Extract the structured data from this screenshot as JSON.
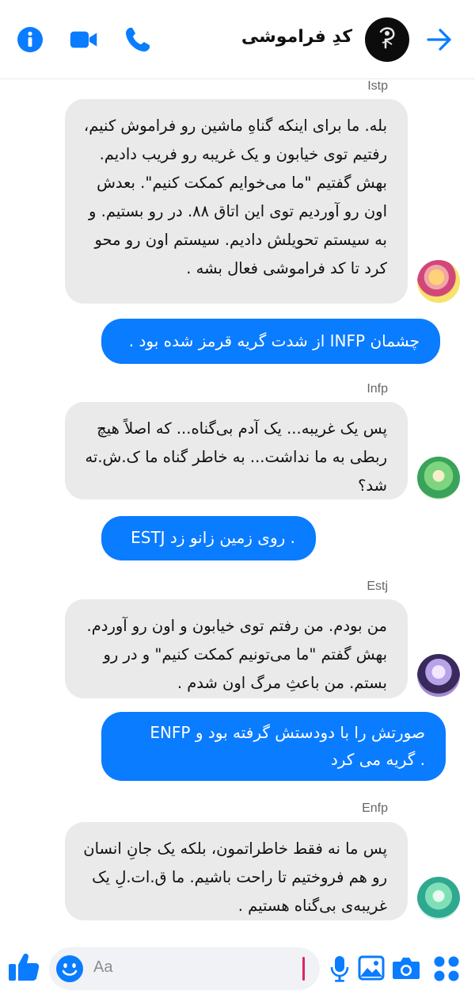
{
  "header": {
    "title": "کدِ فراموشی",
    "icons": [
      "info-icon",
      "video-call-icon",
      "phone-icon",
      "back-arrow-icon"
    ],
    "accent": "#0a7cff"
  },
  "messages": [
    {
      "type": "incoming",
      "sender": "Istp",
      "text": "بله. ما برای اینکه گناهِ ماشین رو فراموش کنیم، رفتیم توی خیابون و یک غریبه رو فریب دادیم. بهش گفتیم \"ما می‌خوایم کمکت کنیم\". بعدش اون رو آوردیم توی این اتاق ۸۸. در رو بستیم. و به سیستم تحویلش دادیم. سیستم اون رو محو کرد تا کد فراموشی فعال بشه ."
    },
    {
      "type": "outgoing",
      "text": "چشمان INFP از شدت گریه قرمز شده بود ."
    },
    {
      "type": "incoming",
      "sender": "Infp",
      "text": "پس یک غریبه... یک آدم بی‌گناه... که اصلاً هیچ ربطی به ما نداشت... به خاطر گناه ما ک.ش.ته شد؟"
    },
    {
      "type": "outgoing",
      "text": "ESTJ روی زمین زانو زد ."
    },
    {
      "type": "incoming",
      "sender": "Estj",
      "text": "من بودم. من رفتم توی خیابون و اون رو آوردم. بهش گفتم \"ما می‌تونیم کمکت کنیم\" و در رو بستم. من باعثِ مرگ اون شدم ."
    },
    {
      "type": "outgoing",
      "text": "ENFP صورتش را با دودستش گرفته بود و گریه می کرد ."
    },
    {
      "type": "incoming",
      "sender": "Enfp",
      "text": "پس ما نه فقط خاطراتمون، بلکه یک جانِ انسان رو هم فروختیم تا راحت باشیم. ما ق.ات.لِ یک غریبه‌ی بی‌گناه هستیم ."
    }
  ],
  "composer": {
    "placeholder": "Aa",
    "icons": [
      "like-icon",
      "emoji-icon",
      "microphone-icon",
      "gallery-icon",
      "camera-icon",
      "apps-icon"
    ]
  }
}
